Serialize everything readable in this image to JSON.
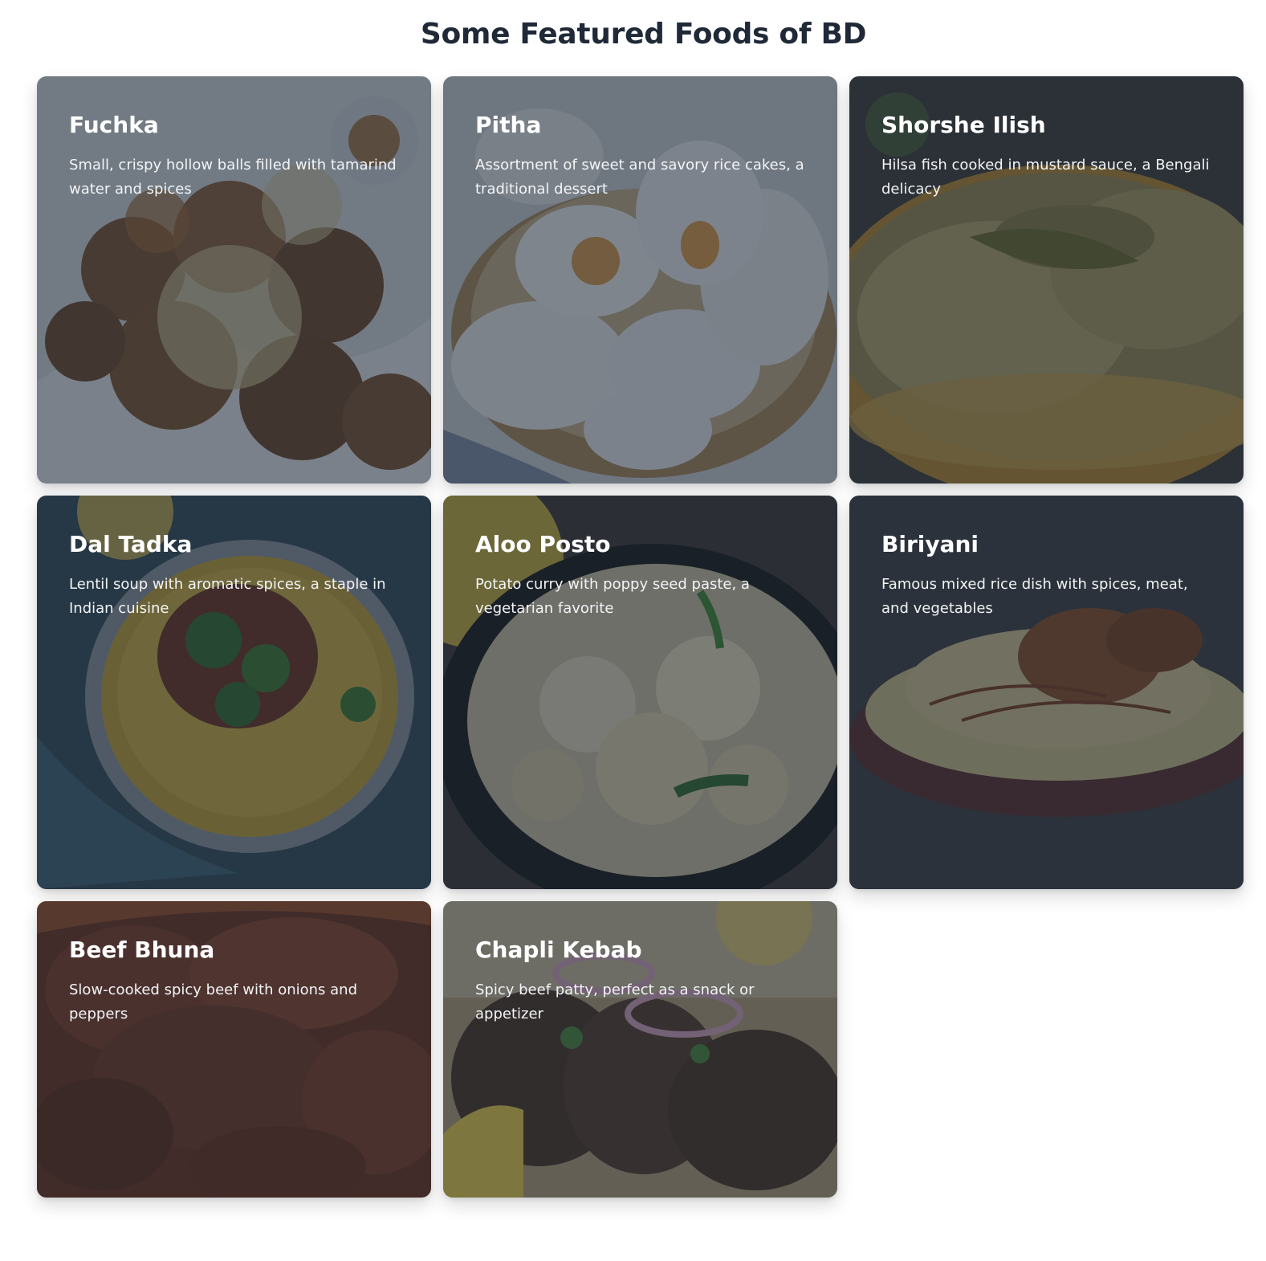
{
  "page": {
    "title": "Some Featured Foods of BD"
  },
  "foods": [
    {
      "name": "Fuchka",
      "description": "Small, crispy hollow balls filled with tamarind water and spices"
    },
    {
      "name": "Pitha",
      "description": "Assortment of sweet and savory rice cakes, a traditional dessert"
    },
    {
      "name": "Shorshe Ilish",
      "description": "Hilsa fish cooked in mustard sauce, a Bengali delicacy"
    },
    {
      "name": "Dal Tadka",
      "description": "Lentil soup with aromatic spices, a staple in Indian cuisine"
    },
    {
      "name": "Aloo Posto",
      "description": "Potato curry with poppy seed paste, a vegetarian favorite"
    },
    {
      "name": "Biriyani",
      "description": "Famous mixed rice dish with spices, meat, and vegetables"
    },
    {
      "name": "Beef Bhuna",
      "description": "Slow-cooked spicy beef with onions and peppers"
    },
    {
      "name": "Chapli Kebab",
      "description": "Spicy beef patty, perfect as a snack or appetizer"
    }
  ],
  "colors": {
    "title": "#1f2937",
    "overlay": "rgba(31, 41, 55, 0.55)",
    "card_text": "#ffffff"
  }
}
